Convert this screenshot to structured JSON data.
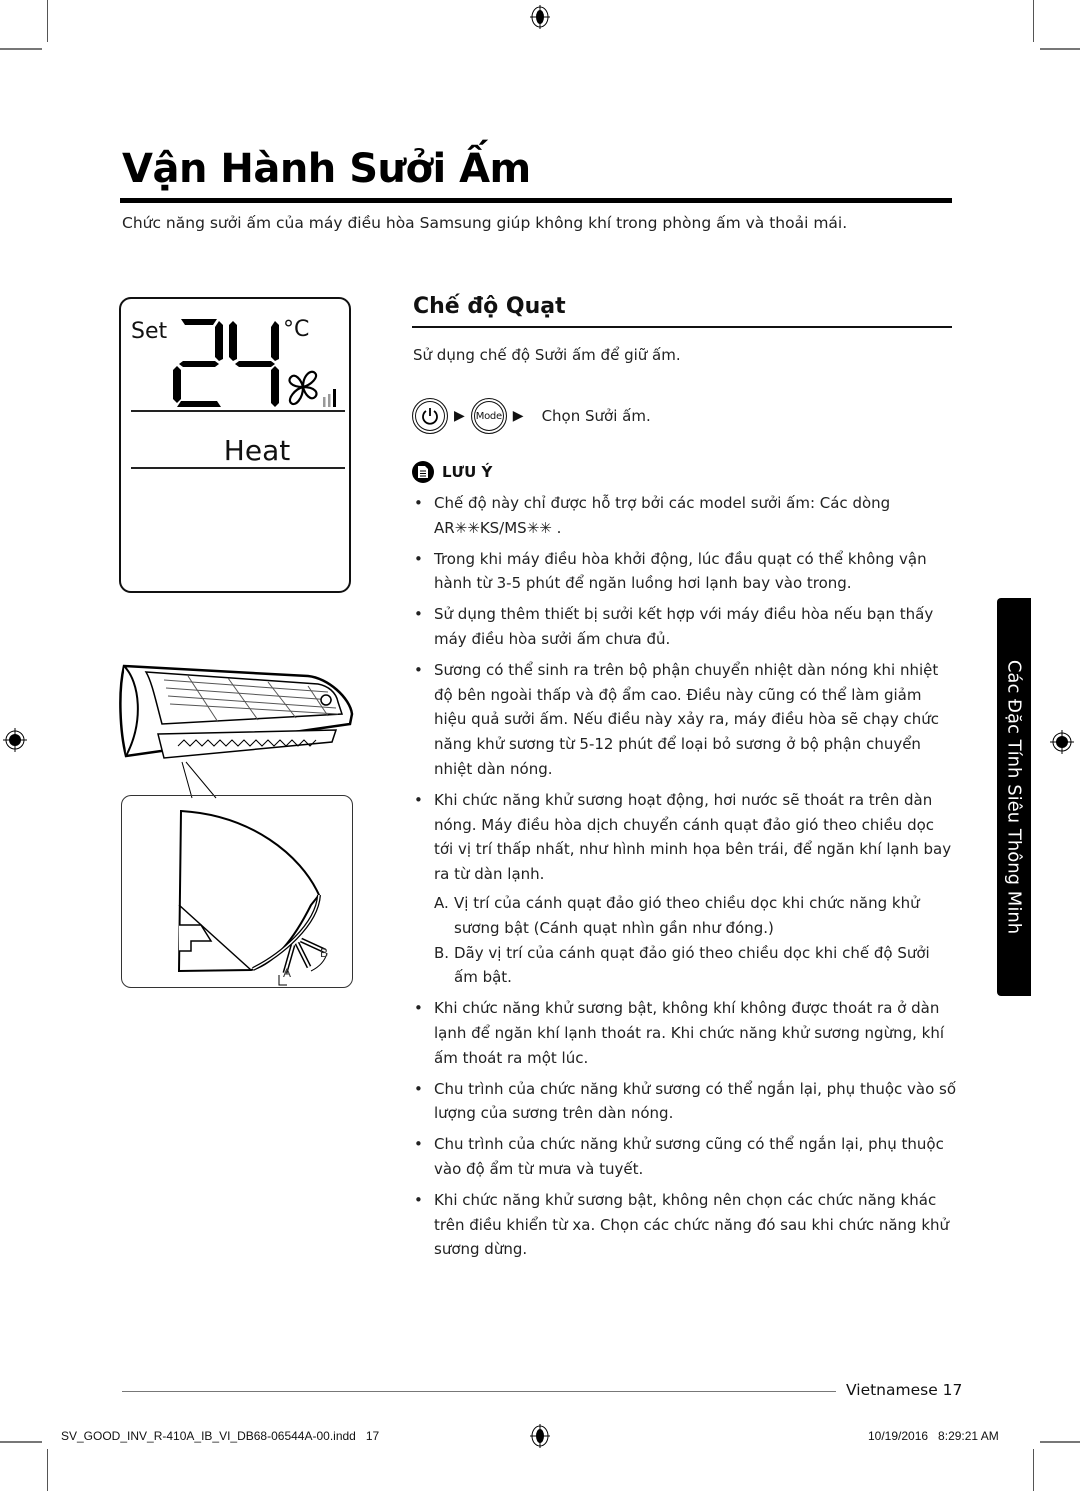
{
  "page": {
    "title": "Vận Hành Sưởi Ấm",
    "intro": "Chức năng sưởi ấm của máy điều hòa Samsung giúp không khí trong phòng ấm và thoải mái."
  },
  "lcd": {
    "set_label": "Set",
    "temperature": "24",
    "unit": "°C",
    "mode": "Heat",
    "fan_icon": "fan-icon",
    "fan_speed_level": "1 of 3"
  },
  "section": {
    "title": "Chế độ  Quạt",
    "intro": "Sử dụng chế độ Sưởi ấm để giữ ấm.",
    "steps": {
      "power_icon": "power-icon",
      "arrow": "▶",
      "mode_button": "Mode",
      "instruction": "Chọn Sưởi ấm."
    },
    "note": {
      "icon": "note-icon",
      "label": "LƯU Ý",
      "bullet": "•",
      "items": [
        "Chế độ này chỉ được hỗ trợ bởi các model sưởi ấm: Các dòng AR✳✳KS/MS✳✳ .",
        "Trong khi máy điều hòa khởi động, lúc đầu quạt có thể không vận hành từ 3-5 phút để ngăn luồng hơi lạnh bay vào trong.",
        "Sử dụng thêm thiết bị sưởi kết hợp với máy điều hòa nếu bạn thấy máy điều hòa sưởi ấm chưa đủ.",
        "Sương có thể sinh ra trên bộ phận chuyển nhiệt dàn nóng khi nhiệt độ bên ngoài thấp và độ ẩm cao.  Điều này cũng có thể làm giảm hiệu quả sưởi ấm. Nếu điều này xảy ra, máy điều hòa sẽ chạy chức năng khử sương từ 5-12 phút để loại bỏ sương ở bộ phận chuyển nhiệt dàn nóng.",
        "Khi chức năng khử sương hoạt động, hơi nước sẽ thoát ra trên dàn nóng. Máy điều hòa dịch chuyển cánh quạt đảo gió theo chiều dọc tới vị trí thấp nhất, như hình minh họa bên trái, để ngăn khí lạnh bay ra từ dàn lạnh.",
        "Khi chức năng khử sương bật, không khí không được thoát ra ở dàn lạnh để ngăn khí lạnh thoát ra.  Khi chức năng khử sương ngừng, khí ấm thoát ra một lúc.",
        "Chu trình của chức năng khử sương có thể ngắn lại, phụ thuộc vào số lượng của sương trên dàn nóng.",
        "Chu trình của chức năng khử sương cũng có thể ngắn lại, phụ thuộc vào độ ẩm từ mưa và tuyết.",
        "Khi chức năng khử sương bật, không nên chọn các chức năng khác trên điều khiển từ xa. Chọn các chức năng đó sau khi chức năng khử sương dừng."
      ],
      "sub_items": [
        {
          "letter": "A.",
          "text": "Vị trí của cánh quạt đảo gió theo chiều dọc khi chức năng khử sương bật (Cánh quạt nhìn gần như đóng.)"
        },
        {
          "letter": "B.",
          "text": "Dãy vị trí của cánh quạt đảo gió theo chiều dọc khi chế độ Sưởi ấm bật."
        }
      ]
    }
  },
  "illustration": {
    "label_a": "A",
    "label_b": "B"
  },
  "side_tab": "Các Đặc Tính Siêu Thông Minh",
  "footer": {
    "page_label": "Vietnamese 17",
    "slug_file": "SV_GOOD_INV_R-410A_IB_VI_DB68-06544A-00.indd   17",
    "slug_date": "10/19/2016   8:29:21 AM"
  }
}
